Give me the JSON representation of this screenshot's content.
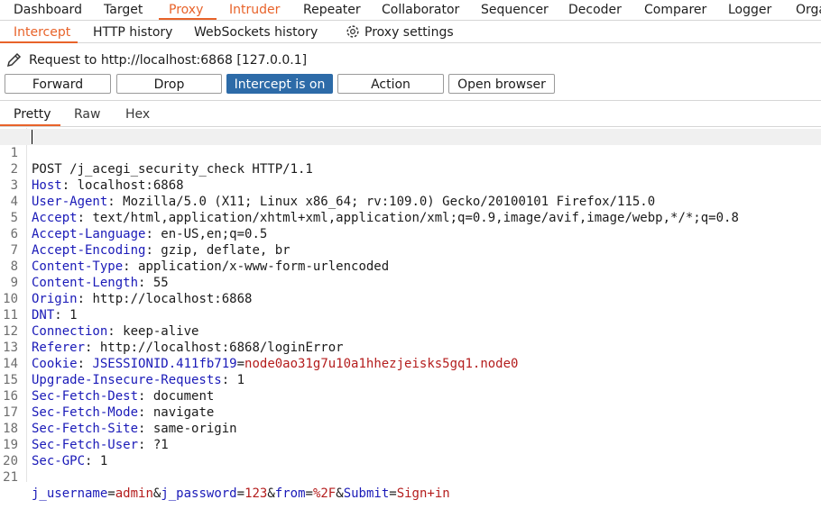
{
  "main_tabs": [
    "Dashboard",
    "Target",
    "Proxy",
    "Intruder",
    "Repeater",
    "Collaborator",
    "Sequencer",
    "Decoder",
    "Comparer",
    "Logger",
    "Orga"
  ],
  "sub_tabs": [
    "Intercept",
    "HTTP history",
    "WebSockets history",
    "Proxy settings"
  ],
  "request_label": "Request to http://localhost:6868  [127.0.0.1]",
  "buttons": [
    "Forward",
    "Drop",
    "Intercept is on",
    "Action",
    "Open browser"
  ],
  "view_tabs": [
    "Pretty",
    "Raw",
    "Hex"
  ],
  "request": {
    "request_line": "POST /j_acegi_security_check HTTP/1.1",
    "headers": [
      {
        "name": "Host",
        "value": "localhost:6868"
      },
      {
        "name": "User-Agent",
        "value": "Mozilla/5.0 (X11; Linux x86_64; rv:109.0) Gecko/20100101 Firefox/115.0"
      },
      {
        "name": "Accept",
        "value": "text/html,application/xhtml+xml,application/xml;q=0.9,image/avif,image/webp,*/*;q=0.8"
      },
      {
        "name": "Accept-Language",
        "value": "en-US,en;q=0.5"
      },
      {
        "name": "Accept-Encoding",
        "value": "gzip, deflate, br"
      },
      {
        "name": "Content-Type",
        "value": "application/x-www-form-urlencoded"
      },
      {
        "name": "Content-Length",
        "value": "55"
      },
      {
        "name": "Origin",
        "value": "http://localhost:6868"
      },
      {
        "name": "DNT",
        "value": "1"
      },
      {
        "name": "Connection",
        "value": "keep-alive"
      },
      {
        "name": "Referer",
        "value": "http://localhost:6868/loginError"
      },
      {
        "name": "Cookie",
        "value": "JSESSIONID.411fb719=node0ao31g7u10a1hhezjeisks5gq1.node0",
        "cookie_name": "JSESSIONID.411fb719",
        "cookie_value": "node0ao31g7u10a1hhezjeisks5gq1.node0"
      },
      {
        "name": "Upgrade-Insecure-Requests",
        "value": "1"
      },
      {
        "name": "Sec-Fetch-Dest",
        "value": "document"
      },
      {
        "name": "Sec-Fetch-Mode",
        "value": "navigate"
      },
      {
        "name": "Sec-Fetch-Site",
        "value": "same-origin"
      },
      {
        "name": "Sec-Fetch-User",
        "value": "?1"
      },
      {
        "name": "Sec-GPC",
        "value": "1"
      }
    ],
    "body_params": [
      {
        "name": "j_username",
        "value": "admin"
      },
      {
        "name": "j_password",
        "value": "123"
      },
      {
        "name": "from",
        "value": "%2F"
      },
      {
        "name": "Submit",
        "value": "Sign+in"
      }
    ]
  },
  "line_numbers": [
    "1",
    "2",
    "3",
    "4",
    "5",
    "6",
    "7",
    "8",
    "9",
    "10",
    "11",
    "12",
    "13",
    "14",
    "15",
    "16",
    "17",
    "18",
    "19",
    "20",
    "21"
  ],
  "colors": {
    "accent": "#e8632a",
    "primary_button": "#2d6ba8",
    "header_name": "#1a1ab8",
    "param_value": "#b41d1d"
  }
}
